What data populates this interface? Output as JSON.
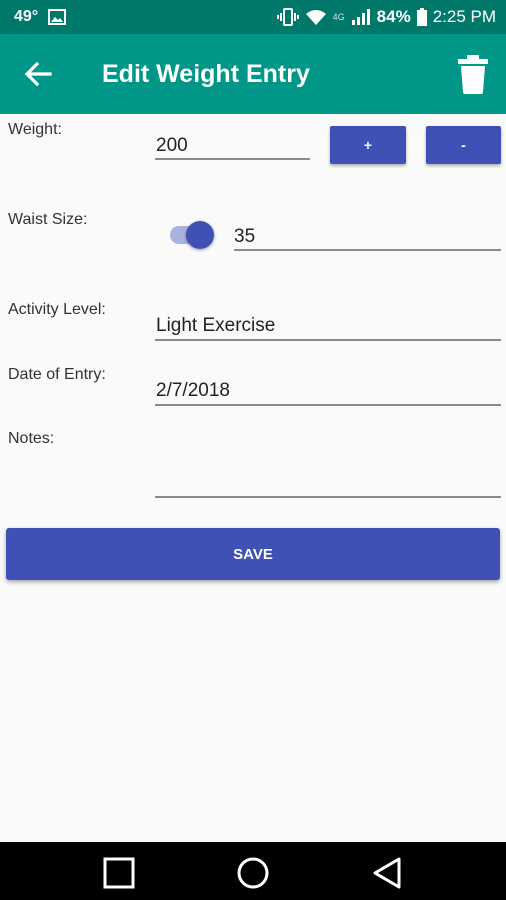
{
  "status_bar": {
    "temperature": "49°",
    "network": "4G",
    "battery_percent": "84%",
    "time": "2:25 PM"
  },
  "app_bar": {
    "title": "Edit Weight Entry",
    "back_icon": "arrow-left-icon",
    "delete_icon": "trash-icon"
  },
  "form": {
    "weight_label": "Weight:",
    "weight_value": "200",
    "increment_label": "+",
    "decrement_label": "-",
    "waist_label": "Waist Size:",
    "waist_toggle_on": true,
    "waist_value": "35",
    "activity_label": "Activity Level:",
    "activity_value": "Light Exercise",
    "date_label": "Date of Entry:",
    "date_value": "2/7/2018",
    "notes_label": "Notes:",
    "notes_value": ""
  },
  "save_label": "SAVE",
  "colors": {
    "status_bar": "#00796b",
    "app_bar": "#009688",
    "accent": "#3f51b5"
  }
}
